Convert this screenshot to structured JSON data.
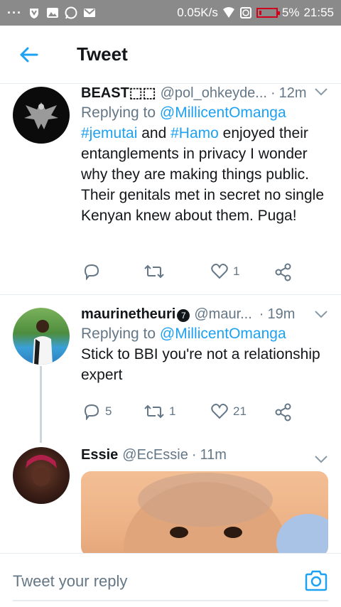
{
  "status_bar": {
    "network_speed": "0.05K/s",
    "battery": "5%",
    "time": "21:55"
  },
  "header": {
    "title": "Tweet"
  },
  "tweets": [
    {
      "name": "BEAST⬚⬚",
      "handle": "@pol_ohkeyde...",
      "separator": "·",
      "time": "12m",
      "replying_prefix": "Replying to",
      "replying_to": "@MillicentOmanga",
      "body_tag1": "#jemutai",
      "body_mid": " and ",
      "body_tag2": "#Hamo",
      "body_rest": " enjoyed their entanglements in privacy I wonder why they are making things public. Their genitals met in secret no single Kenyan knew about them. Puga!",
      "replies": "",
      "retweets": "",
      "likes": "1"
    },
    {
      "name": "maurinetheuri",
      "badge": "7",
      "handle": "@maur...",
      "separator": "·",
      "time": "19m",
      "replying_prefix": "Replying to",
      "replying_to": "@MillicentOmanga",
      "body": "Stick to BBI you're not a relationship expert",
      "replies": "5",
      "retweets": "1",
      "likes": "21"
    },
    {
      "name": "Essie",
      "handle": "@EcEssie",
      "separator": "·",
      "time": "11m"
    }
  ],
  "reply_bar": {
    "placeholder": "Tweet your reply"
  },
  "icons": {
    "back": "arrow-left-icon",
    "caret": "chevron-down-icon",
    "reply": "reply-icon",
    "retweet": "retweet-icon",
    "like": "heart-icon",
    "share": "share-icon",
    "camera": "camera-icon"
  },
  "colors": {
    "accent": "#1da1f2",
    "muted": "#657786",
    "text": "#14171a"
  }
}
